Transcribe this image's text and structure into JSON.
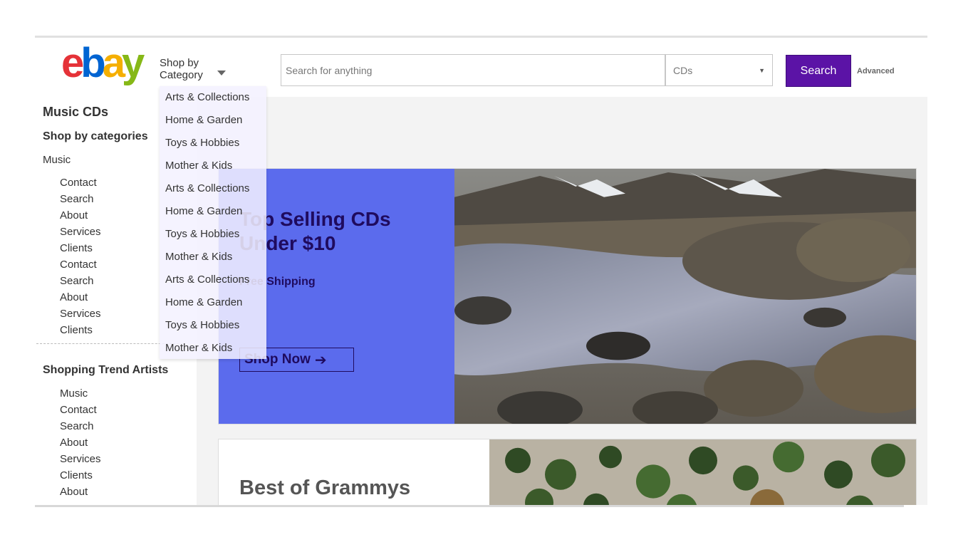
{
  "header": {
    "logo": {
      "e": "e",
      "b": "b",
      "a": "a",
      "y": "y"
    },
    "shop_by_category": "Shop by Category",
    "search": {
      "placeholder": "Search for anything"
    },
    "category_select": {
      "value": "CDs"
    },
    "search_button": "Search",
    "advanced_link": "Advanced"
  },
  "dropdown": {
    "items": [
      "Arts & Collections",
      "Home & Garden",
      "Toys & Hobbies",
      "Mother & Kids",
      "Arts & Collections",
      "Home & Garden",
      "Toys & Hobbies",
      "Mother & Kids",
      "Arts & Collections",
      "Home & Garden",
      "Toys & Hobbies",
      "Mother & Kids"
    ]
  },
  "sidebar": {
    "title": "Music CDs",
    "subtitle": "Shop by categories",
    "category": "Music",
    "links": [
      "Contact",
      "Search",
      "About",
      "Services",
      "Clients",
      "Contact",
      "Search",
      "About",
      "Services",
      "Clients"
    ],
    "trend_title": "Shopping Trend Artists",
    "trend_links": [
      "Music",
      "Contact",
      "Search",
      "About",
      "Services",
      "Clients",
      "About"
    ]
  },
  "hero": {
    "title": "Top Selling CDs Under $10",
    "subtitle": "Free Shipping",
    "button": "Shop Now",
    "button_icon": "arrow-right-icon",
    "accent_color": "#5b6bed",
    "text_color": "#1f0b5e"
  },
  "card2": {
    "title": "Best of Grammys"
  },
  "colors": {
    "search_button": "#5b13a6",
    "logo_e": "#e53238",
    "logo_b": "#0064d2",
    "logo_a": "#f5af02",
    "logo_y": "#86b817"
  }
}
